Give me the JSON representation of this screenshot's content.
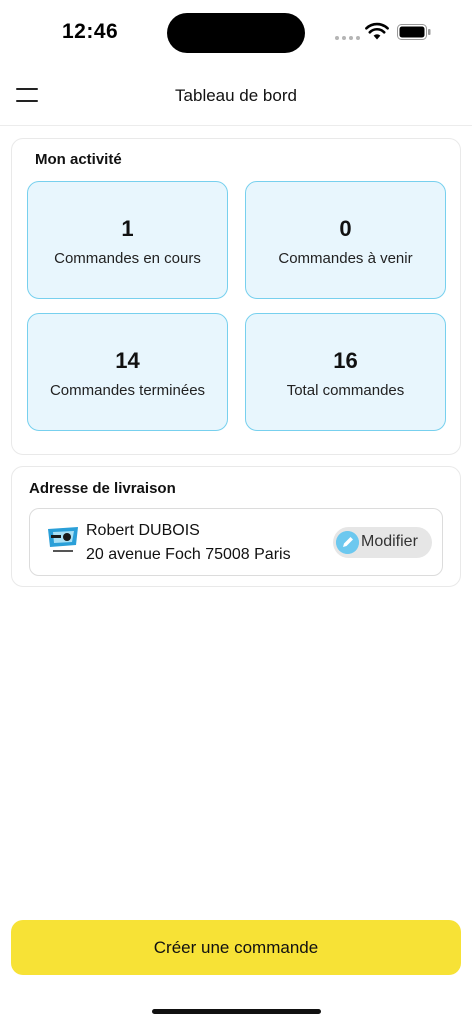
{
  "status_bar": {
    "time": "12:46"
  },
  "header": {
    "title": "Tableau de bord",
    "menu_icon": "hamburger-menu-icon"
  },
  "activity": {
    "title": "Mon activité",
    "stats": [
      {
        "value": "1",
        "label": "Commandes en cours"
      },
      {
        "value": "0",
        "label": "Commandes à venir"
      },
      {
        "value": "14",
        "label": "Commandes terminées"
      },
      {
        "value": "16",
        "label": "Total commandes"
      }
    ]
  },
  "address": {
    "title": "Adresse de livraison",
    "name": "Robert DUBOIS",
    "street": "20 avenue Foch 75008 Paris",
    "edit_label": "Modifier",
    "edit_icon": "pencil-icon"
  },
  "cta": {
    "label": "Créer une commande"
  },
  "colors": {
    "stat_bg": "#e8f6fd",
    "stat_border": "#77d0ee",
    "cta_bg": "#f7e236",
    "edit_icon_bg": "#6cc8ef"
  }
}
